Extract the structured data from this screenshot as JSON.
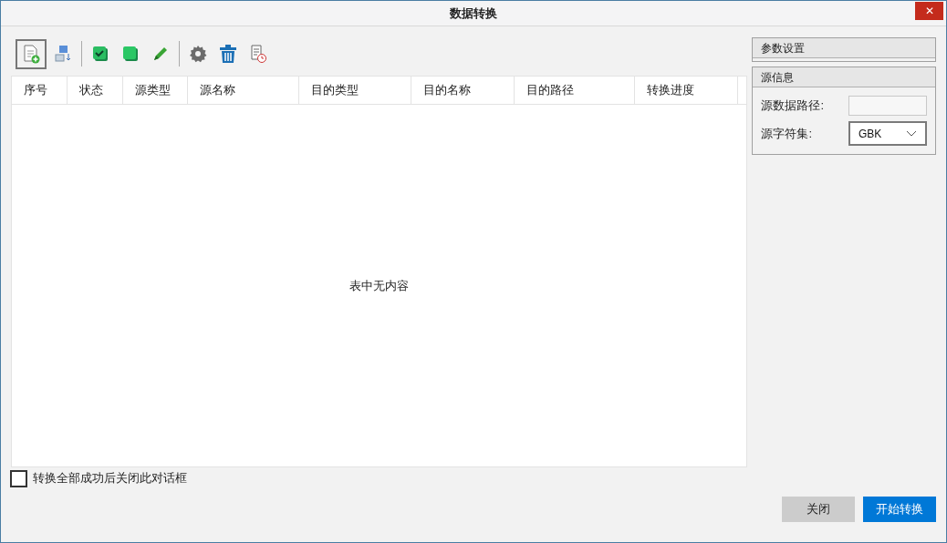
{
  "window": {
    "title": "数据转换",
    "close": "✕"
  },
  "toolbar": [
    {
      "kind": "new-doc",
      "selected": true
    },
    {
      "kind": "stack-down",
      "selected": false
    },
    {
      "kind": "divider"
    },
    {
      "kind": "check-square",
      "selected": false
    },
    {
      "kind": "green-square",
      "selected": false
    },
    {
      "kind": "pencil",
      "selected": false
    },
    {
      "kind": "divider"
    },
    {
      "kind": "gear",
      "selected": false
    },
    {
      "kind": "trash",
      "selected": false
    },
    {
      "kind": "doc-clock",
      "selected": false
    }
  ],
  "table": {
    "columns": [
      "序号",
      "状态",
      "源类型",
      "源名称",
      "目的类型",
      "目的名称",
      "目的路径",
      "转换进度"
    ],
    "empty_text": "表中无内容"
  },
  "panels": [
    {
      "title": "参数设置"
    },
    {
      "title": "源信息",
      "fields": [
        {
          "kind": "text",
          "label": "源数据路径:"
        },
        {
          "kind": "select",
          "label": "源字符集:",
          "value": "GBK"
        }
      ]
    }
  ],
  "close_when_done": {
    "label": "转换全部成功后关闭此对话框",
    "checked": false
  },
  "buttons": [
    {
      "label": "关闭",
      "primary": false
    },
    {
      "label": "开始转换",
      "primary": true
    }
  ]
}
